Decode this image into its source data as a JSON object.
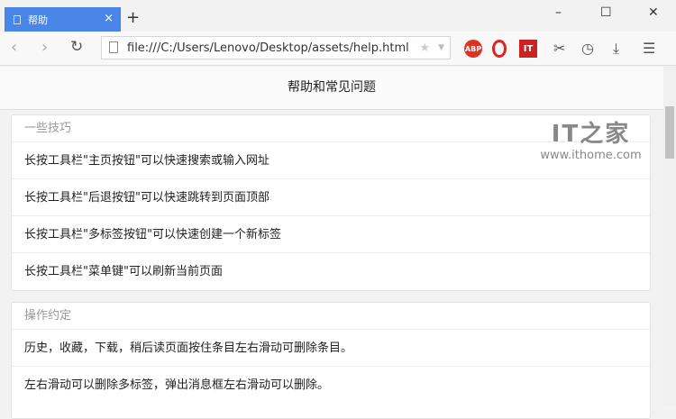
{
  "tab": {
    "title": "帮助",
    "close": "×",
    "new": "+"
  },
  "window": {
    "minimize": "–",
    "maximize": "☐",
    "close": "✕"
  },
  "toolbar": {
    "url": "file:///C:/Users/Lenovo/Desktop/assets/help.html",
    "ext_abp": "ABP",
    "ext_it": "IT"
  },
  "page": {
    "title": "帮助和常见问题",
    "sections": [
      {
        "title": "一些技巧",
        "items": [
          "长按工具栏\"主页按钮\"可以快速搜索或输入网址",
          "长按工具栏\"后退按钮\"可以快速跳转到页面顶部",
          "长按工具栏\"多标签按钮\"可以快速创建一个新标签",
          "长按工具栏\"菜单键\"可以刷新当前页面"
        ]
      },
      {
        "title": "操作约定",
        "items": [
          "历史，收藏，下载，稍后读页面按住条目左右滑动可删除条目。",
          "左右滑动可以删除多标签，弹出消息框左右滑动可以删除。"
        ]
      }
    ]
  },
  "watermark": {
    "logo": "IT之家",
    "site": "www.ithome.com"
  }
}
